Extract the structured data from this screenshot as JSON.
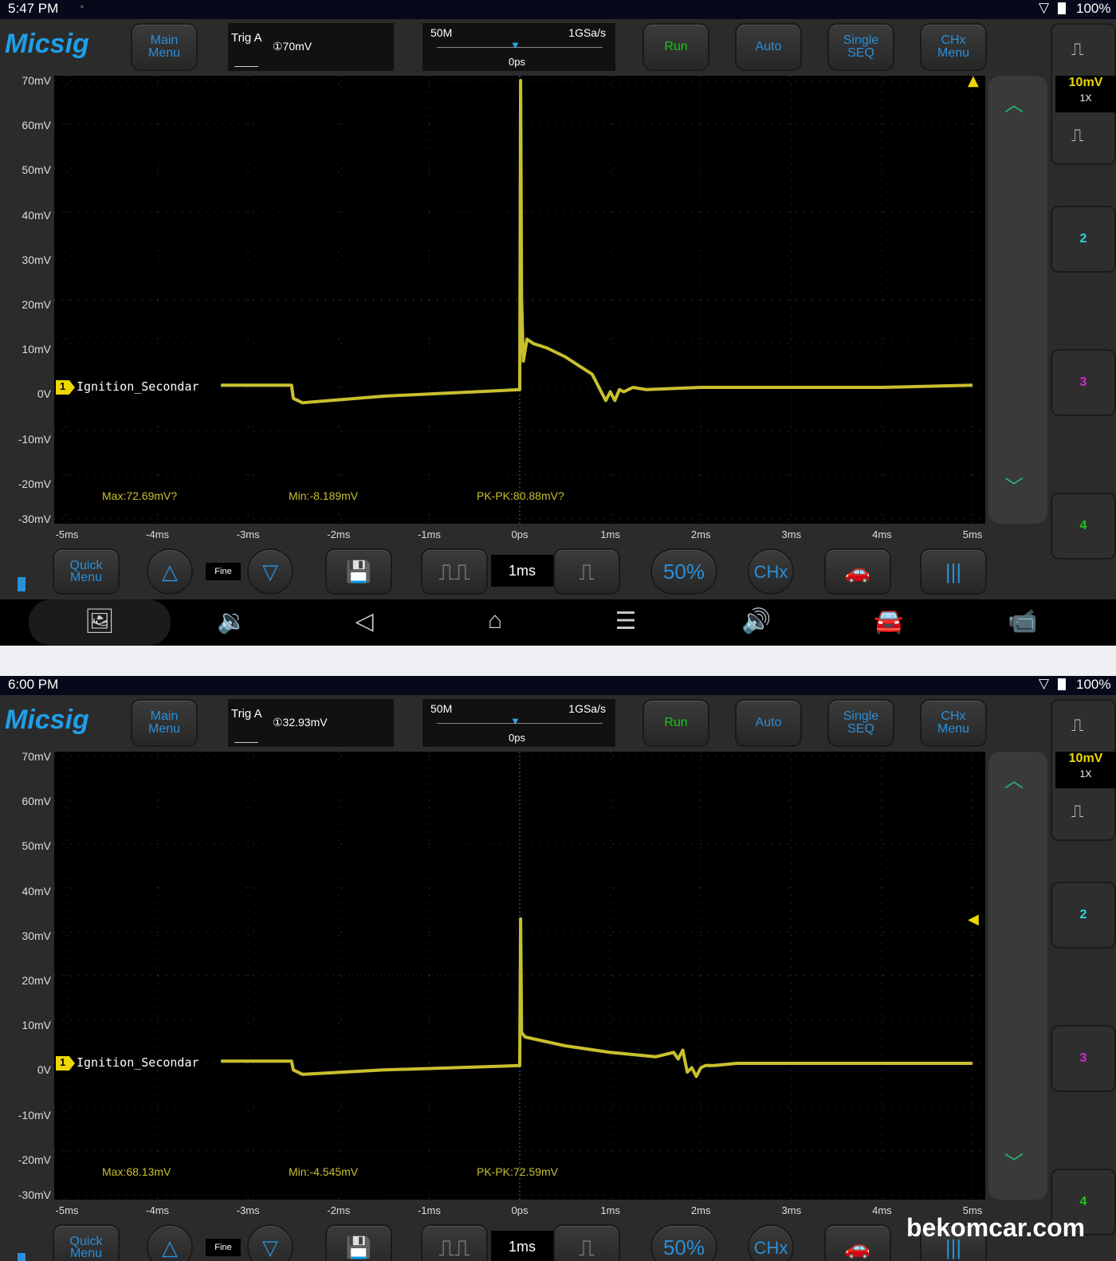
{
  "watermark": "bekomcar.com",
  "colors": {
    "trace": "#c9c02e",
    "accent": "#2a8fd8",
    "run": "#1ec41e",
    "ch2": "#2ad8e0",
    "ch3": "#d02ad0",
    "ch4": "#1ec41e"
  },
  "common": {
    "logo": "Micsig",
    "buttons": {
      "main_menu": "Main\nMenu",
      "run": "Run",
      "auto": "Auto",
      "single_seq": "Single\nSEQ",
      "chx_menu": "CHx\nMenu"
    },
    "trig_label": "Trig A",
    "timebase": {
      "mem": "50M",
      "rate": "1GSa/s",
      "pos": "0ps"
    },
    "ch1_scale": "10mV",
    "ch1_probe": "1X",
    "channels": [
      "2",
      "3",
      "4"
    ],
    "y_ticks": [
      "70mV",
      "60mV",
      "50mV",
      "40mV",
      "30mV",
      "20mV",
      "10mV",
      "0V",
      "-10mV",
      "-20mV",
      "-30mV"
    ],
    "x_ticks": [
      "-5ms",
      "-4ms",
      "-3ms",
      "-2ms",
      "-1ms",
      "0ps",
      "1ms",
      "2ms",
      "3ms",
      "4ms",
      "5ms"
    ],
    "channel_label": "Ignition_Secondar",
    "channel_number": "1",
    "bottom": {
      "quick_menu": "Quick\nMenu",
      "fine": "Fine",
      "time_div": "1ms",
      "fifty": "50%",
      "chx": "CHx"
    },
    "status_pct": "100%"
  },
  "screenshots": [
    {
      "status_time": "5:47 PM",
      "trig_value": "①70mV",
      "measurements": {
        "max": "Max:72.69mV?",
        "min": "Min:-8.189mV",
        "pkpk": "PK-PK:80.88mV?"
      },
      "chart_data": {
        "type": "line",
        "x_unit": "ms",
        "y_unit": "mV",
        "xlim": [
          -5,
          5
        ],
        "ylim": [
          -30,
          70
        ],
        "series": [
          {
            "name": "Ignition_Secondar",
            "x": [
              -5,
              -3.3,
              -2.52,
              -2.5,
              -2.4,
              -1.5,
              0,
              0.01,
              0.02,
              0.04,
              0.08,
              0.15,
              0.3,
              0.5,
              0.65,
              0.8,
              0.9,
              0.95,
              1.0,
              1.05,
              1.1,
              1.15,
              1.25,
              1.4,
              2.0,
              3.0,
              4.0,
              5.0
            ],
            "y": [
              0,
              0.5,
              0.5,
              -2.5,
              -3.5,
              -2,
              -0.5,
              70,
              20,
              6,
              11,
              10,
              9,
              7,
              5,
              3,
              -1,
              -3,
              -1,
              -3,
              -0.5,
              -1,
              0,
              -0.5,
              0,
              0,
              0,
              0.5
            ]
          }
        ]
      }
    },
    {
      "status_time": "6:00 PM",
      "trig_value": "①32.93mV",
      "measurements": {
        "max": "Max:68.13mV",
        "min": "Min:-4.545mV",
        "pkpk": "PK-PK:72.59mV"
      },
      "chart_data": {
        "type": "line",
        "x_unit": "ms",
        "y_unit": "mV",
        "xlim": [
          -5,
          5
        ],
        "ylim": [
          -30,
          70
        ],
        "series": [
          {
            "name": "Ignition_Secondar",
            "x": [
              -5,
              -3.3,
              -2.52,
              -2.5,
              -2.4,
              -1.5,
              0,
              0.01,
              0.02,
              0.06,
              0.5,
              1.0,
              1.5,
              1.7,
              1.75,
              1.8,
              1.85,
              1.9,
              1.95,
              2.0,
              2.05,
              2.15,
              2.4,
              3.0,
              4.0,
              5.0
            ],
            "y": [
              0,
              0.5,
              0.5,
              -1.5,
              -2.5,
              -1.5,
              -0.5,
              32.93,
              7,
              6,
              4,
              2.5,
              1.5,
              2.5,
              1,
              3,
              -2,
              -1,
              -3,
              -1,
              -0.5,
              -0.5,
              0,
              0,
              0,
              0
            ]
          }
        ]
      }
    }
  ]
}
